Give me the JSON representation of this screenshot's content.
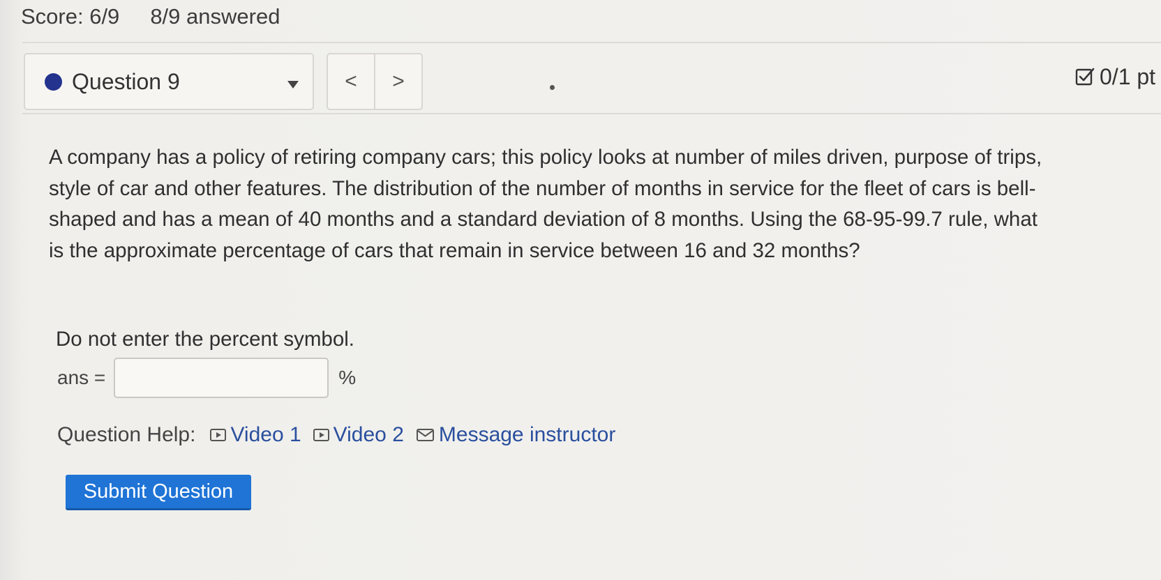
{
  "header": {
    "score": "Score: 6/9",
    "answered": "8/9 answered"
  },
  "question_nav": {
    "current_question": "Question 9",
    "status_color": "#23338e",
    "prev_label": "<",
    "next_label": ">",
    "points": "0/1 pt"
  },
  "question": {
    "text": "A company has a policy of retiring company cars; this policy looks at number of miles driven, purpose of trips, style of car and other features. The distribution of the number of months in service for the fleet of cars is bell-shaped and has a mean of 40 months and a standard deviation of 8 months. Using the 68-95-99.7 rule, what is the approximate percentage of cars that remain in service between 16 and 32 months?",
    "instruction": "Do not enter the percent symbol.",
    "answer_label": "ans =",
    "answer_value": "",
    "answer_unit": "%"
  },
  "help": {
    "label": "Question Help:",
    "links": [
      {
        "label": "Video 1",
        "icon": "video-icon"
      },
      {
        "label": "Video 2",
        "icon": "video-icon"
      },
      {
        "label": "Message instructor",
        "icon": "mail-icon"
      }
    ]
  },
  "submit_label": "Submit Question",
  "colors": {
    "link": "#2a4f9e",
    "submit": "#1f74d6"
  }
}
